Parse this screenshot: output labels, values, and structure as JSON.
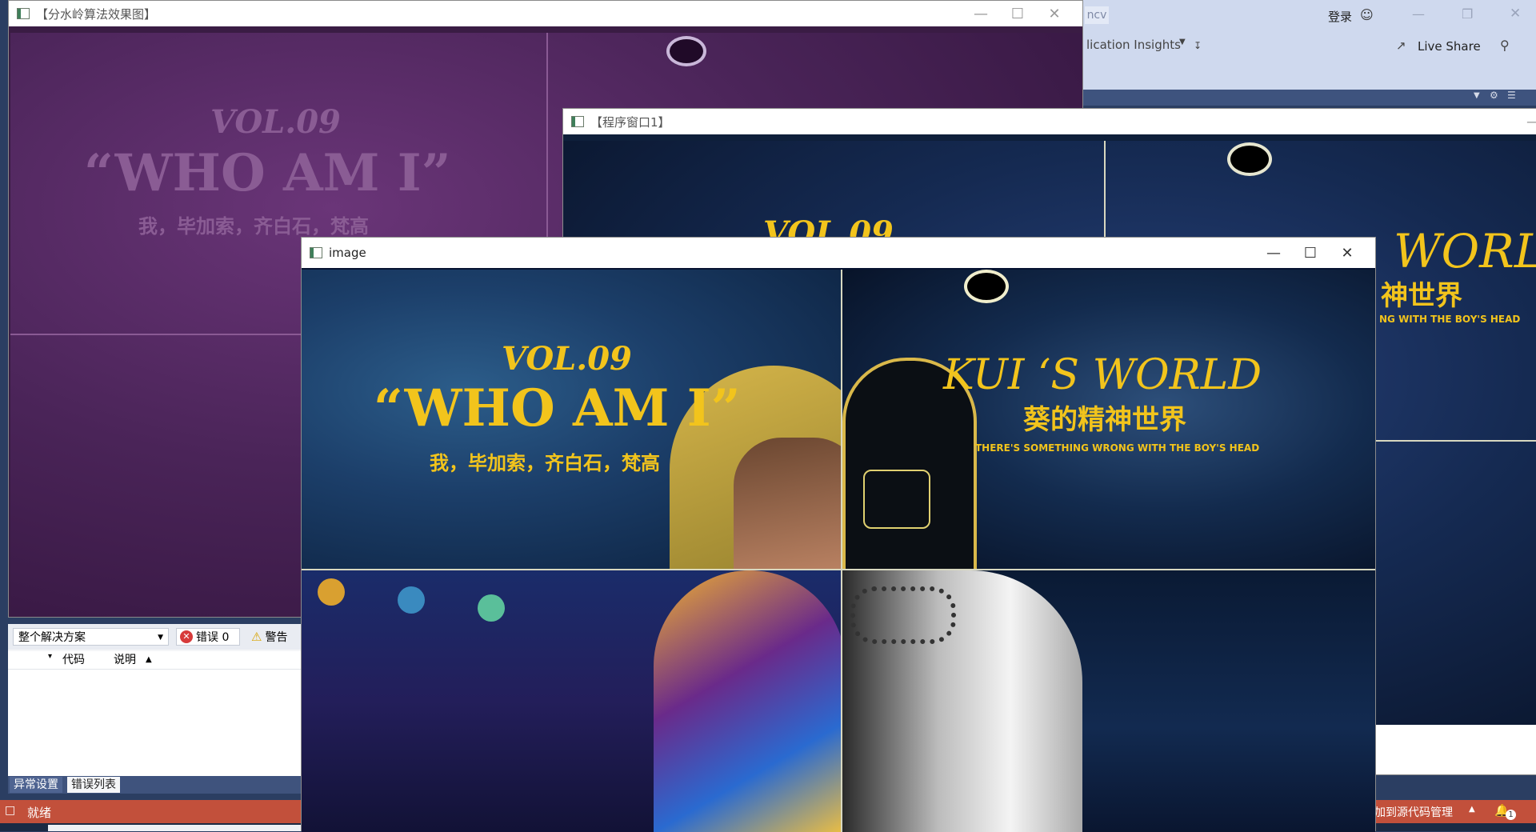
{
  "vs": {
    "app_partial_title": "ncv",
    "login": "登录",
    "insights_menu": "lication Insights",
    "live_share": "Live Share",
    "status_ready": "就绪",
    "source_control": "加到源代码管理",
    "notification_count": "1"
  },
  "error_list": {
    "scope_select": "整个解决方案",
    "errors_label": "错误 0",
    "warnings_label": "警告",
    "col_code": "代码",
    "col_desc": "说明",
    "tab_exceptions": "异常设置",
    "tab_errors": "错误列表"
  },
  "windows": {
    "watershed_title": "【分水岭算法效果图】",
    "program_title": "【程序窗口1】",
    "image_title": "image"
  },
  "poster": {
    "vol": "VOL.09",
    "who": "“WHO AM I”",
    "names": "我，毕加索，齐白石，梵高",
    "kui": "KUI ‘S  WORLD",
    "kui_cn": "葵的精神世界",
    "tagline": "THERE'S SOMETHING WRONG WITH THE BOY'S HEAD",
    "world_partial": "WORLD",
    "cn_partial": "神世界",
    "tag_partial": "NG WITH THE BOY'S HEAD"
  },
  "colors": {
    "poster_gold": "#f2c41c",
    "purple_tint": "#5a2b62",
    "status_bar": "#c2503b"
  }
}
